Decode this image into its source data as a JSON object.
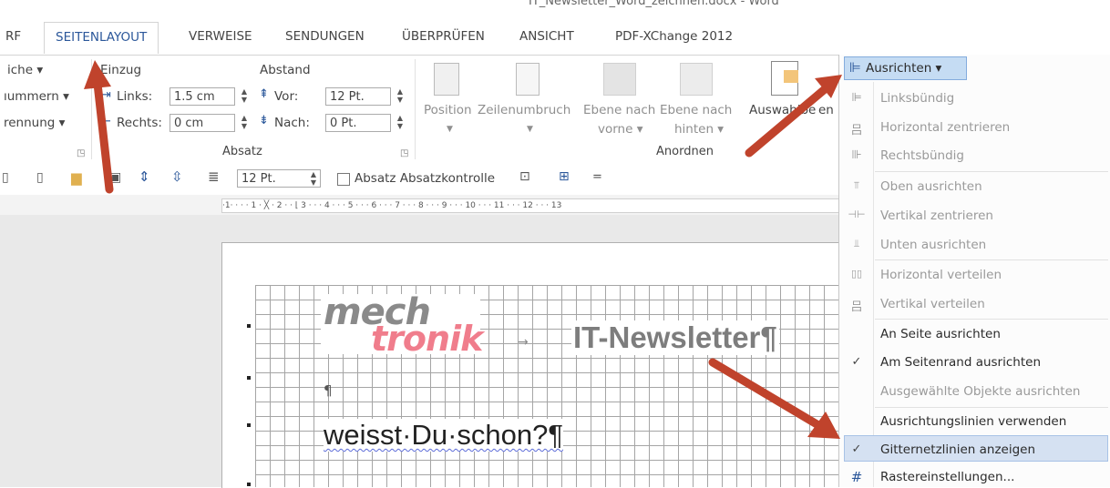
{
  "title_bar": {
    "document_title": "IT_Newsletter_Word_zeichnen.docx - Word"
  },
  "tabs": [
    "RF",
    "SEITENLAYOUT",
    "VERWEISE",
    "SENDUNGEN",
    "ÜBERPRÜFEN",
    "ANSICHT",
    "PDF-XChange 2012"
  ],
  "ribbon": {
    "left_items": [
      "iche ▾",
      "ıummern ▾",
      "rennung ▾"
    ],
    "einzug_label": "Einzug",
    "abstand_label": "Abstand",
    "links_label": "Links:",
    "links_value": "1.5 cm",
    "rechts_label": "Rechts:",
    "rechts_value": "0 cm",
    "vor_label": "Vor:",
    "vor_value": "12 Pt.",
    "nach_label": "Nach:",
    "nach_value": "0 Pt.",
    "absatz_group": "Absatz",
    "anordnen_group": "Anordnen",
    "position_label": "Position",
    "zeilenumbruch_label": "Zeilenumbruch",
    "ebene_vorne_label": "Ebene nach",
    "ebene_vorne_sub": "vorne ▾",
    "ebene_hinten_label": "Ebene nach",
    "ebene_hinten_sub": "hinten ▾",
    "auswahlbereich_label": "Auswahlbe",
    "auswahlbereich_tail": "en"
  },
  "toolbar2": {
    "spacing_value": "12 Pt.",
    "absatzkontrolle_label": "Absatz Absatzkontrolle",
    "more": "="
  },
  "ruler": {
    "text": "·1·  · · · 1 · ╳ · 2 · · ⌊ 3 · · · 4 · · · 5 · · · 6 · · · 7 · · · 8 · · · 9 · · · 10 · · · 11 · · · 12 · · · 13"
  },
  "document": {
    "logo_top": "mech",
    "logo_bottom": "tronik",
    "tab_arrow": "→",
    "heading": "IT-Newsletter¶",
    "empty_para": "¶",
    "body_text": "weisst·Du·schon?¶"
  },
  "menu": {
    "button_label": "Ausrichten ▾",
    "items": [
      {
        "label": "Linksbündig",
        "enabled": false,
        "checked": false,
        "icon": "align-left-icon"
      },
      {
        "label": "Horizontal zentrieren",
        "enabled": false,
        "checked": false,
        "icon": "align-center-icon"
      },
      {
        "label": "Rechtsbündig",
        "enabled": false,
        "checked": false,
        "icon": "align-right-icon"
      },
      {
        "label": "Oben ausrichten",
        "enabled": false,
        "checked": false,
        "icon": "align-top-icon"
      },
      {
        "label": "Vertikal zentrieren",
        "enabled": false,
        "checked": false,
        "icon": "align-middle-icon"
      },
      {
        "label": "Unten ausrichten",
        "enabled": false,
        "checked": false,
        "icon": "align-bottom-icon"
      },
      {
        "label": "Horizontal verteilen",
        "enabled": false,
        "checked": false,
        "icon": "distribute-horizontal-icon"
      },
      {
        "label": "Vertikal verteilen",
        "enabled": false,
        "checked": false,
        "icon": "distribute-vertical-icon"
      },
      {
        "label": "An Seite ausrichten",
        "enabled": true,
        "checked": false,
        "icon": ""
      },
      {
        "label": "Am Seitenrand ausrichten",
        "enabled": true,
        "checked": true,
        "icon": "checkmark-icon"
      },
      {
        "label": "Ausgewählte Objekte ausrichten",
        "enabled": false,
        "checked": false,
        "icon": ""
      },
      {
        "label": "Ausrichtungslinien verwenden",
        "enabled": true,
        "checked": false,
        "icon": ""
      },
      {
        "label": "Gitternetzlinien anzeigen",
        "enabled": true,
        "checked": true,
        "icon": "checkmark-icon"
      },
      {
        "label": "Rastereinstellungen...",
        "enabled": true,
        "checked": false,
        "icon": "grid-icon"
      }
    ]
  },
  "colors": {
    "accent": "#2b579a",
    "annotation_arrow": "#c0432c",
    "highlight": "#d5e1f2",
    "logo_pink": "#f07d8c"
  }
}
